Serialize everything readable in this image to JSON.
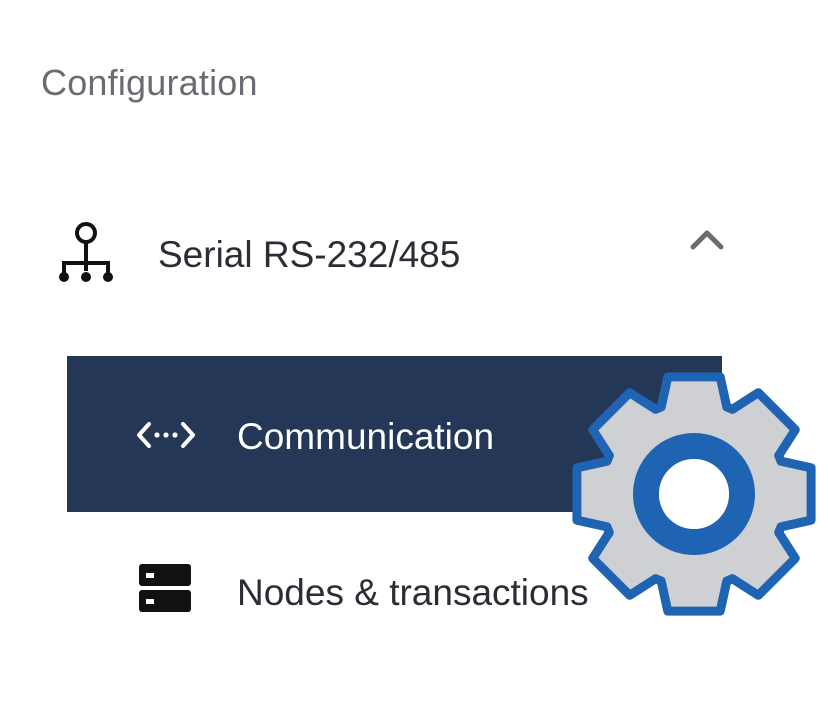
{
  "section": {
    "title": "Configuration"
  },
  "group": {
    "label": "Serial RS-232/485",
    "icon": "network-tree-icon",
    "expanded": true,
    "toggle_icon": "chevron-up-icon"
  },
  "items": [
    {
      "label": "Communication",
      "icon": "code-arrows-icon",
      "active": true
    },
    {
      "label": "Nodes & transactions",
      "icon": "server-icon",
      "active": false
    }
  ],
  "overlay": {
    "icon": "gear-icon"
  },
  "colors": {
    "active_bg": "#243756",
    "gear_fill": "#cfd0d3",
    "gear_stroke": "#1f63b3",
    "title_text": "#6b6b73",
    "body_text": "#2b2d35"
  }
}
